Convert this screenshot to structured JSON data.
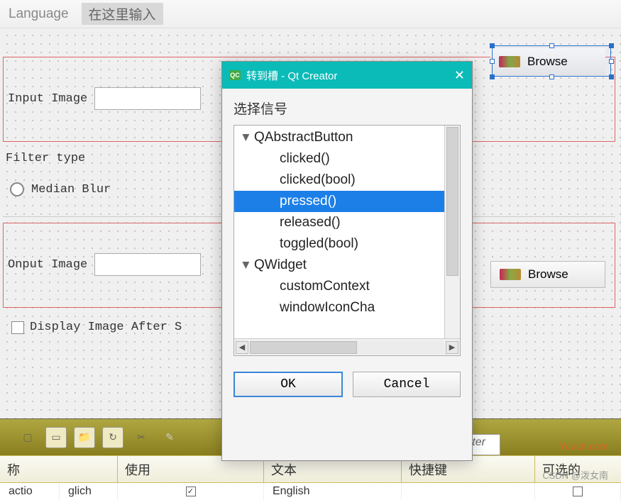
{
  "menubar": {
    "language": "Language",
    "placeholder": "在这里输入"
  },
  "form": {
    "input_label": "Input Image",
    "filter_title": "Filter type",
    "radio_median": "Median Blur",
    "output_label": "Onput Image",
    "browse1": "Browse",
    "browse2": "Browse",
    "display_after": "Display Image After S"
  },
  "dialog": {
    "title": "转到槽 - Qt Creator",
    "select_signal": "选择信号",
    "tree": {
      "p1": "QAbstractButton",
      "c1": "clicked()",
      "c2": "clicked(bool)",
      "c3": "pressed()",
      "c4": "released()",
      "c5": "toggled(bool)",
      "p2": "QWidget",
      "c6": "customContext",
      "c7": "windowIconCha"
    },
    "ok": "OK",
    "cancel": "Cancel"
  },
  "bottom": {
    "filter_stub": "Filter"
  },
  "columns": {
    "name": "称",
    "use": "使用",
    "text": "文本",
    "shortcut": "快捷键",
    "optional": "可选的"
  },
  "row": {
    "c1": "actio",
    "c2": "glich",
    "c4": "English"
  },
  "watermark1": "Yuucn.com",
  "watermark2": "CSDN @泼女南"
}
